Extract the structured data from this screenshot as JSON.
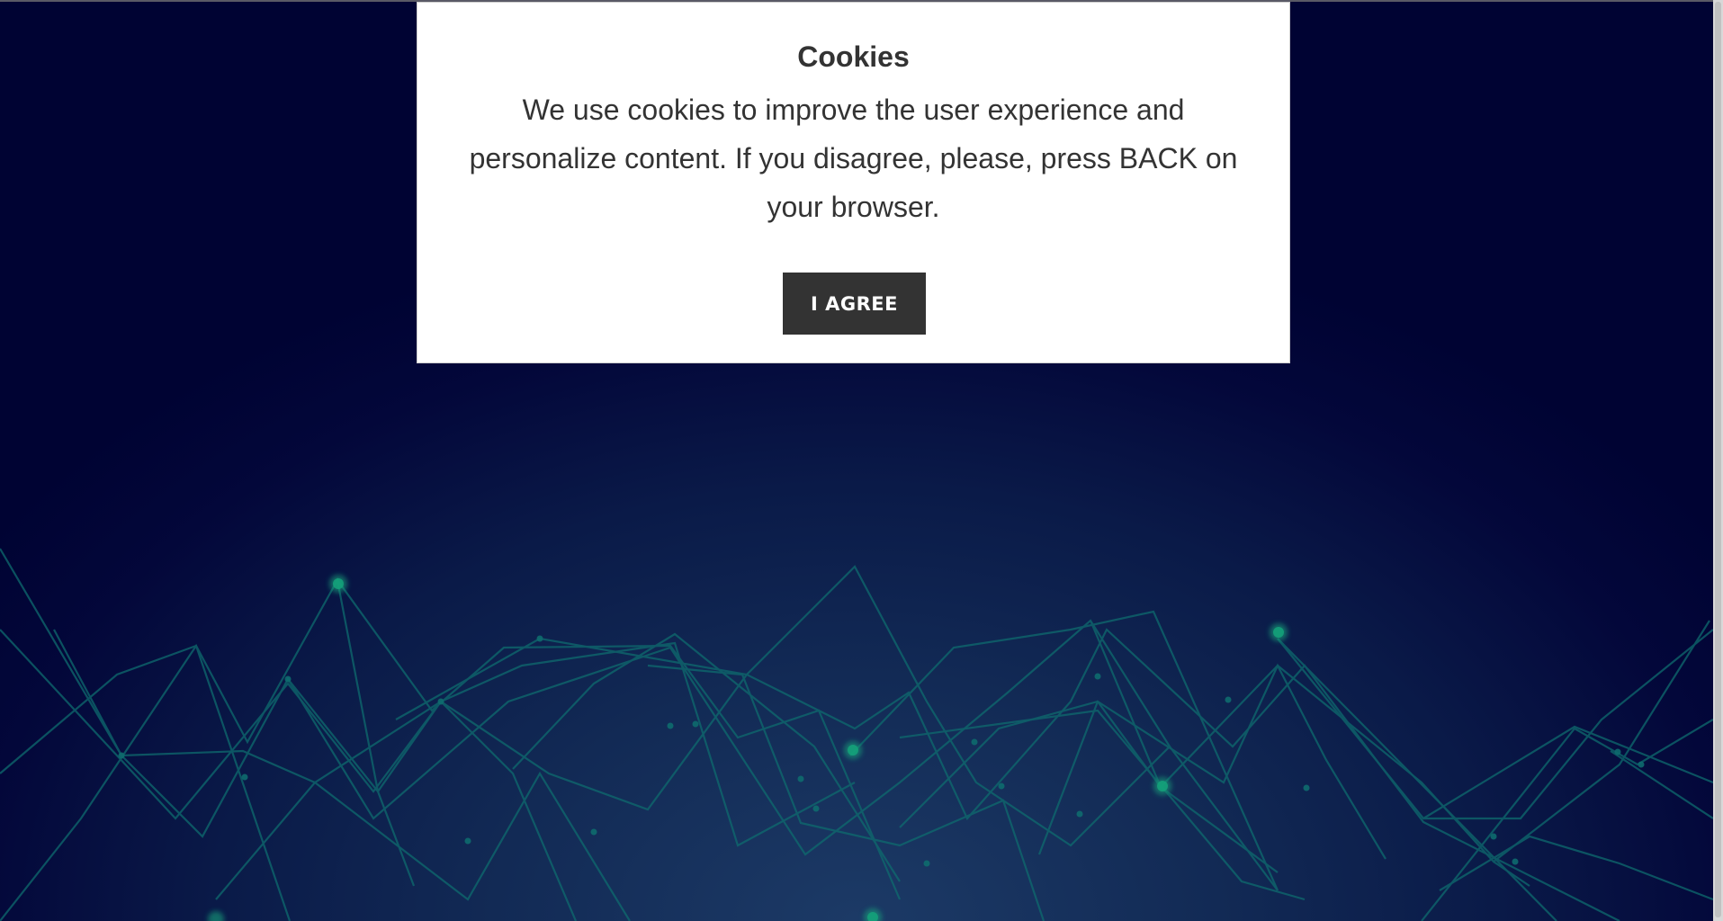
{
  "cookie_banner": {
    "title": "Cookies",
    "message": "We use cookies to improve the user experience and personalize content. If you disagree, please, press BACK on your browser.",
    "agree_label": "I AGREE"
  },
  "colors": {
    "background": "#000333",
    "network_lines": "#0e6b6e",
    "network_nodes": "#14a37a",
    "button": "#333333"
  }
}
